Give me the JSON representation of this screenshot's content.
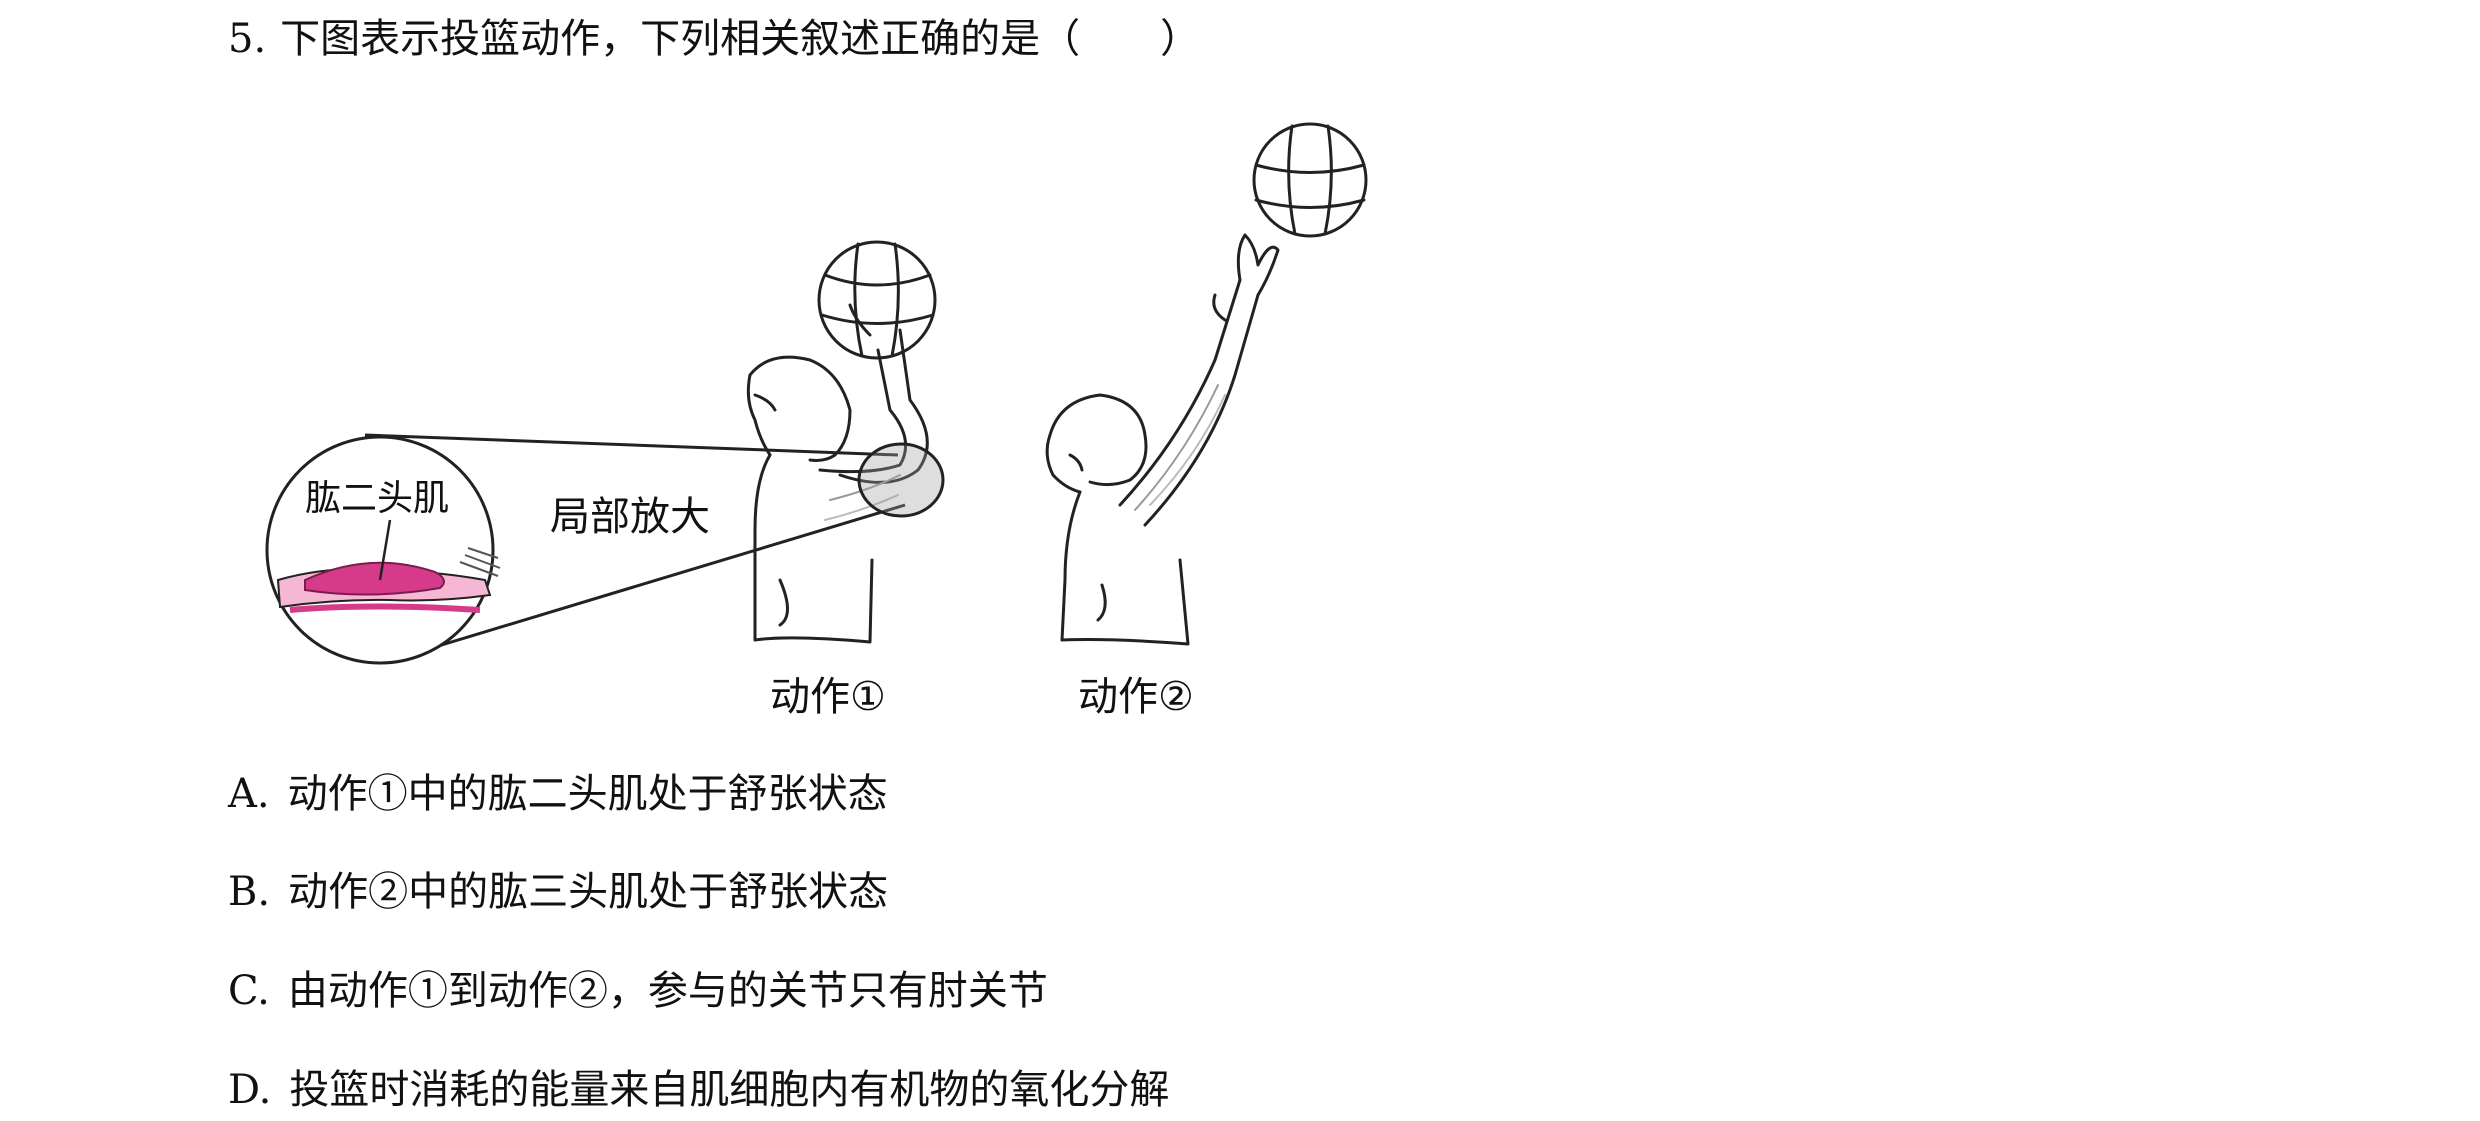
{
  "question": {
    "number": "5.",
    "stem": "下图表示投篮动作，下列相关叙述正确的是（　　）"
  },
  "figure": {
    "magnified_muscle_label": "肱二头肌",
    "zoom_label": "局部放大",
    "action1_label": "动作①",
    "action2_label": "动作②",
    "colors": {
      "muscle": "#d63a8a",
      "muscle_light": "#f5b7d4",
      "line": "#222222"
    }
  },
  "options": [
    {
      "letter": "A.",
      "text": "动作①中的肱二头肌处于舒张状态"
    },
    {
      "letter": "B.",
      "text": "动作②中的肱三头肌处于舒张状态"
    },
    {
      "letter": "C.",
      "text": "由动作①到动作②，参与的关节只有肘关节"
    },
    {
      "letter": "D.",
      "text": "投篮时消耗的能量来自肌细胞内有机物的氧化分解"
    }
  ]
}
